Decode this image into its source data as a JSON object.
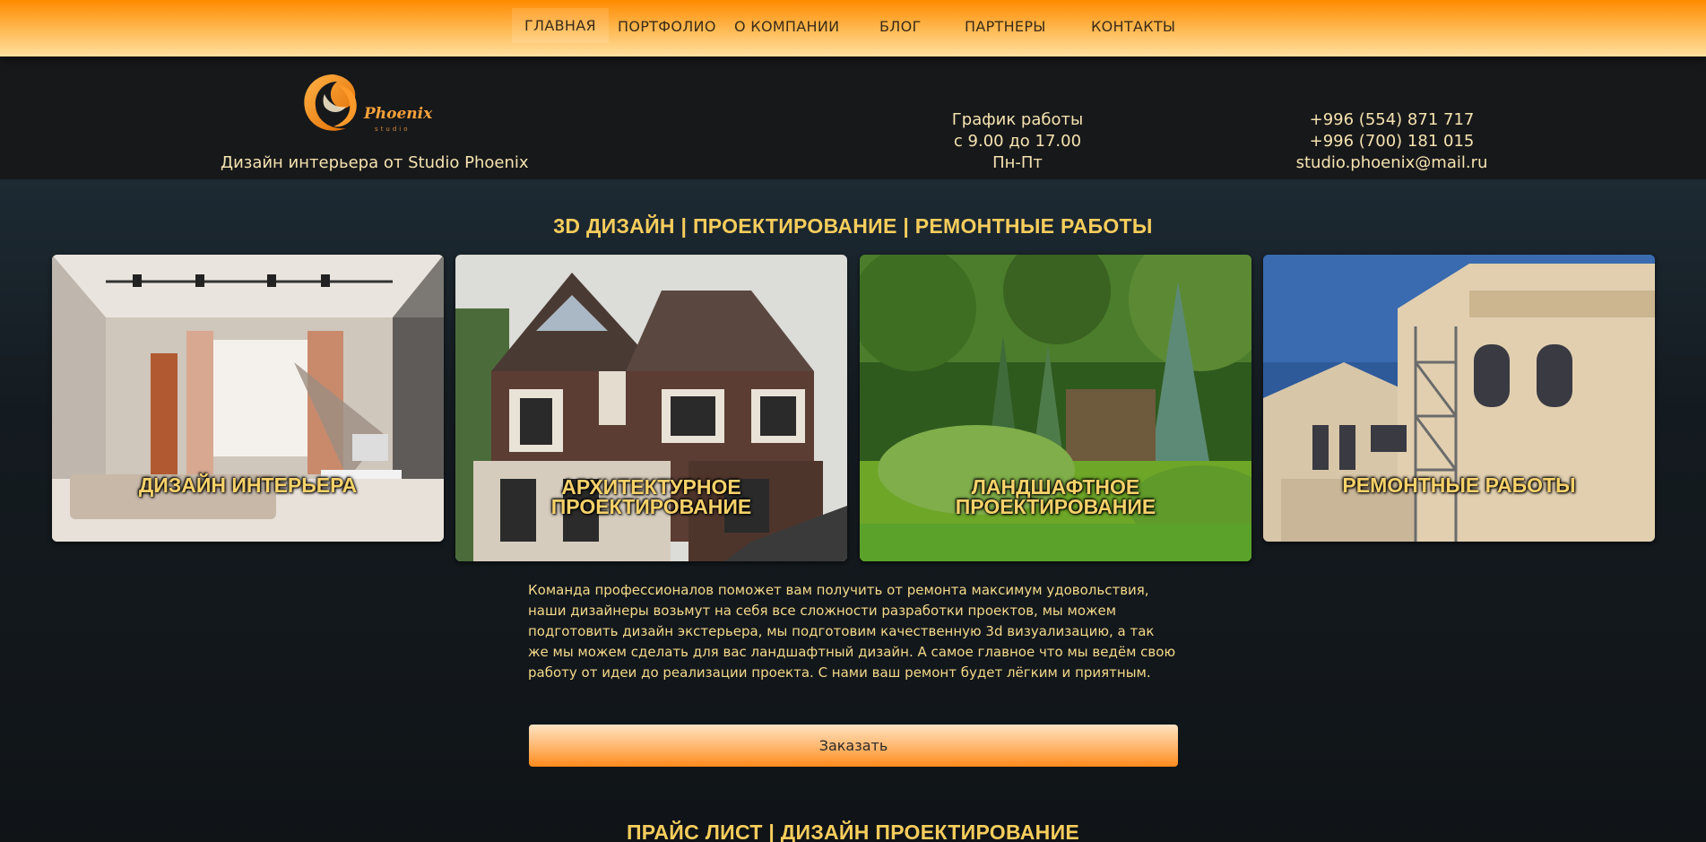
{
  "nav": {
    "items": [
      "ГЛАВНАЯ",
      "ПОРТФОЛИО",
      "О КОМПАНИИ",
      "БЛОГ",
      "ПАРТНЕРЫ",
      "КОНТАКТЫ"
    ]
  },
  "header": {
    "logo_text": "Phoenix",
    "logo_subtext": "studio",
    "tagline": "Дизайн интерьера от Studio Phoenix",
    "schedule": {
      "title": "График работы",
      "hours": "с 9.00 до 17.00",
      "days": "Пн-Пт"
    },
    "contacts": {
      "phone1": "+996 (554) 871 717",
      "phone2": "+996 (700) 181 015",
      "email": "studio.phoenix@mail.ru"
    }
  },
  "main": {
    "services_title": "3D ДИЗАЙН | ПРОЕКТИРОВАНИЕ | РЕМОНТНЫЕ РАБОТЫ",
    "cards": [
      {
        "label": "ДИЗАЙН ИНТЕРЬЕРА"
      },
      {
        "label": "АРХИТЕКТУРНОЕ\nПРОЕКТИРОВАНИЕ"
      },
      {
        "label": "ЛАНДШАФТНОЕ\nПРОЕКТИРОВАНИЕ"
      },
      {
        "label": "РЕМОНТНЫЕ РАБОТЫ"
      }
    ],
    "description": "Команда профессионалов поможет вам получить от ремонта максимум удовольствия, наши дизайнеры возьмут на себя все сложности разработки проектов, мы можем подготовить дизайн экстерьера, мы подготовим качественную 3d визуализацию, а так же мы можем сделать для вас ландшафтный дизайн. А самое главное что мы ведём свою работу от идеи до реализации проекта. С нами ваш ремонт будет лёгким и приятным.",
    "order_button": "Заказать",
    "price_title": "ПРАЙС ЛИСТ | ДИЗАЙН ПРОЕКТИРОВАНИЕ"
  },
  "colors": {
    "accent": "#f7cd5c",
    "nav_gradient_top": "#ff8a00",
    "nav_gradient_bottom": "#ffe0a0",
    "background": "#11161a"
  }
}
